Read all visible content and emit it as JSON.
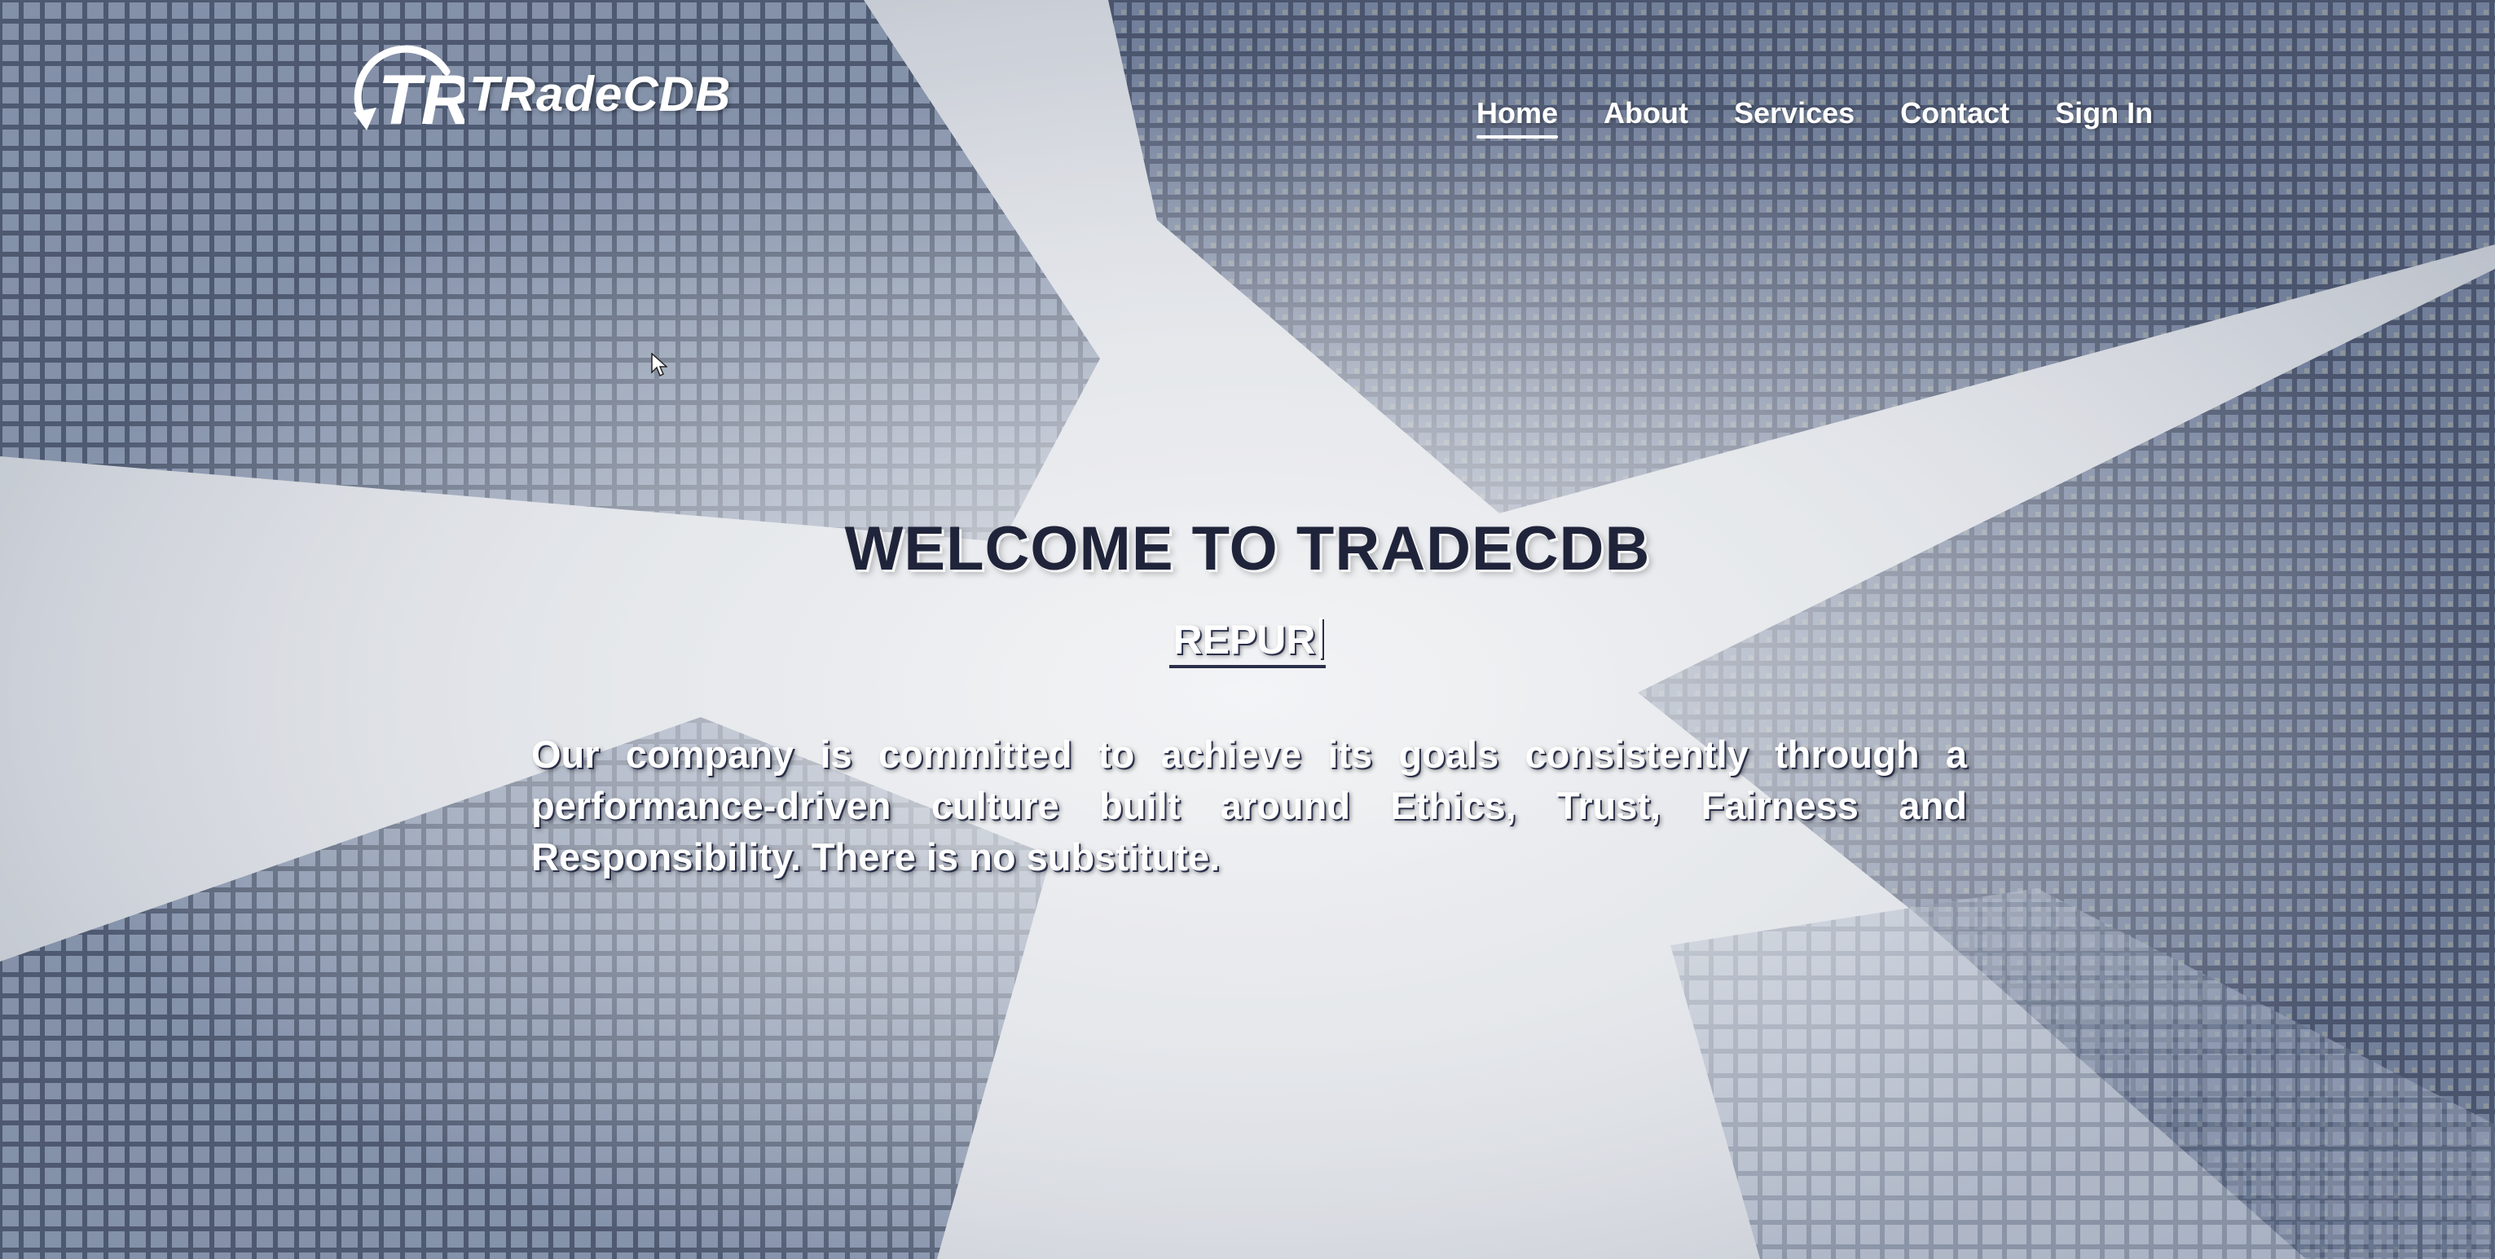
{
  "brand": {
    "name": "TRadeCDB",
    "logo_icon": "tr-swirl-logo-icon"
  },
  "nav": {
    "items": [
      {
        "label": "Home",
        "active": true
      },
      {
        "label": "About",
        "active": false
      },
      {
        "label": "Services",
        "active": false
      },
      {
        "label": "Contact",
        "active": false
      },
      {
        "label": "Sign In",
        "active": false
      }
    ]
  },
  "hero": {
    "title": "WELCOME TO TRADECDB",
    "typed_text": "REPUR",
    "description": "Our company is committed to achieve its goals consistently through a performance-driven culture built around Ethics, Trust, Fairness and Responsibility. There is no substitute."
  },
  "colors": {
    "title": "#20243a",
    "text": "#ffffff",
    "building": "#3a4a66",
    "window_light": "#d9cf86"
  }
}
